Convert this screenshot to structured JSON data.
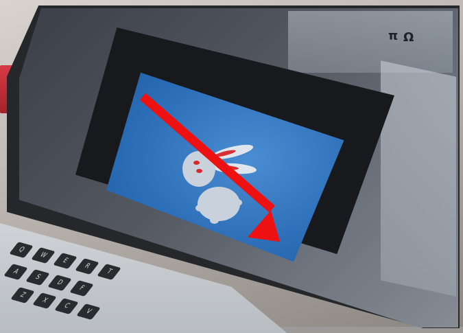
{
  "scene": {
    "description_free": true,
    "slide": {
      "bunny_colors": {
        "body": "#c9d2dc",
        "eyes": "#d62a2a",
        "ear_inner": "#d63030"
      },
      "background_color": "#2c6fb8"
    },
    "annotation": {
      "type": "arrow",
      "direction": "down-right",
      "color": "#ee1111"
    },
    "ribbon_glyphs": [
      "π",
      "Ω"
    ],
    "keyboard_glyphs": [
      "Q",
      "W",
      "E",
      "R",
      "T",
      "A",
      "S",
      "D",
      "F",
      "Z",
      "X",
      "C",
      "V"
    ]
  }
}
